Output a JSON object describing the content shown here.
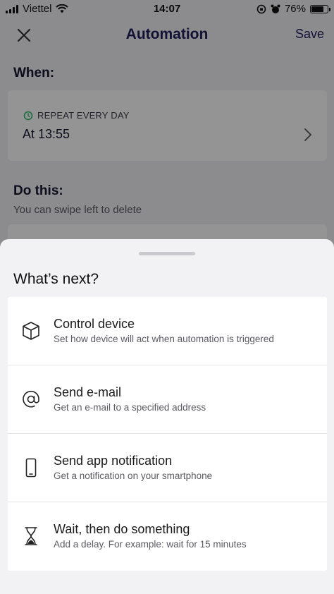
{
  "status_bar": {
    "carrier": "Viettel",
    "time": "14:07",
    "battery": "76%",
    "battery_level": 0.76
  },
  "nav": {
    "title": "Automation",
    "save_label": "Save"
  },
  "when": {
    "heading": "When:",
    "trigger_label": "REPEAT EVERY DAY",
    "trigger_value": "At 13:55"
  },
  "do_this": {
    "heading": "Do this:",
    "hint": "You can swipe left to delete"
  },
  "sheet": {
    "title": "What’s next?",
    "options": [
      {
        "icon": "cube-icon",
        "title": "Control device",
        "description": "Set how device will act when automation is triggered"
      },
      {
        "icon": "at-sign-icon",
        "title": "Send e-mail",
        "description": "Get an e-mail to a specified address"
      },
      {
        "icon": "smartphone-icon",
        "title": "Send app notification",
        "description": "Get a notification on your smartphone"
      },
      {
        "icon": "hourglass-icon",
        "title": "Wait, then do something",
        "description": "Add a delay. For example: wait for 15 minutes"
      }
    ]
  },
  "colors": {
    "accent": "#1e1d5c",
    "clock_icon": "#2bb673",
    "sheet_background": "#f2f2f5"
  }
}
